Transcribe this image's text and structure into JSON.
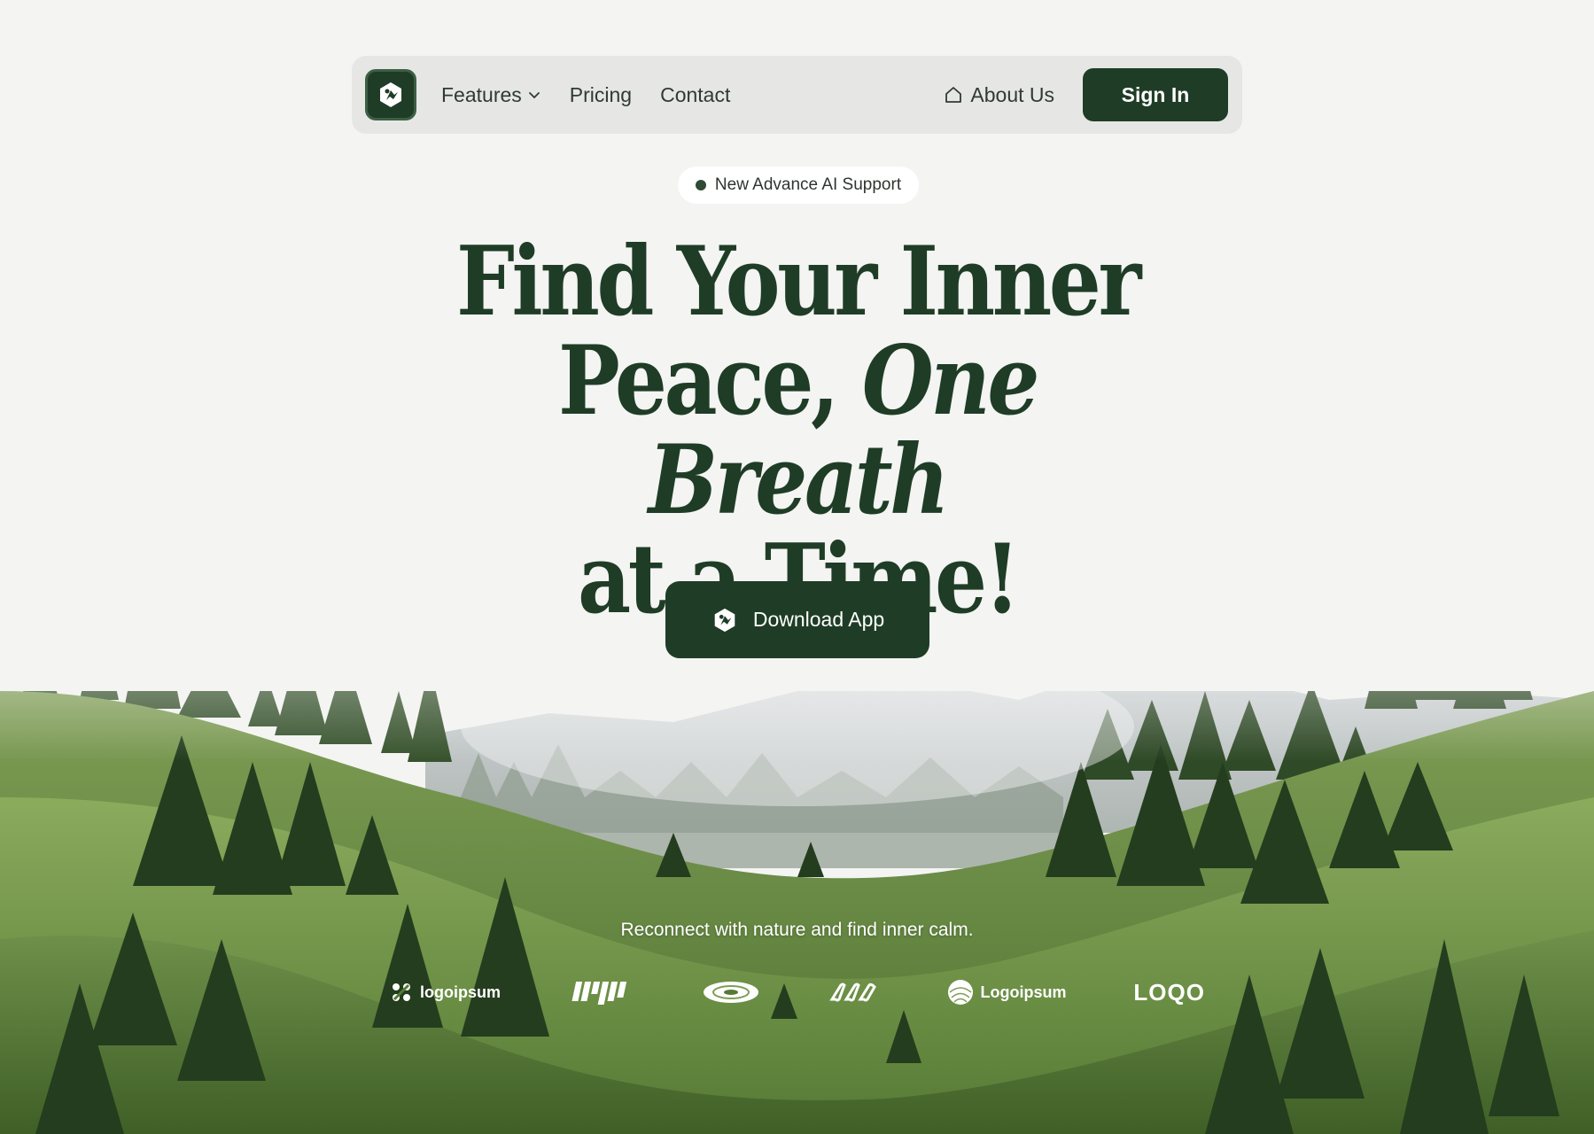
{
  "nav": {
    "logo_icon": "leaf-bird-icon",
    "features_label": "Features",
    "pricing_label": "Pricing",
    "contact_label": "Contact",
    "about_label": "About Us",
    "signin_label": "Sign In"
  },
  "badge": {
    "text": "New Advance AI Support"
  },
  "hero": {
    "line1": "Find Your Inner",
    "line2_plain": "Peace, ",
    "line2_italic": "One Breath",
    "line3": "at a Time!",
    "cta_label": "Download App"
  },
  "tagline": "Reconnect with nature and find inner calm.",
  "partners": {
    "logo1": "logoipsum",
    "logo2": "Logoipsum",
    "logo3": "LOQO"
  },
  "colors": {
    "brand": "#1f3d26",
    "background": "#f4f4f3",
    "nav_bg": "#e6e7e5"
  }
}
